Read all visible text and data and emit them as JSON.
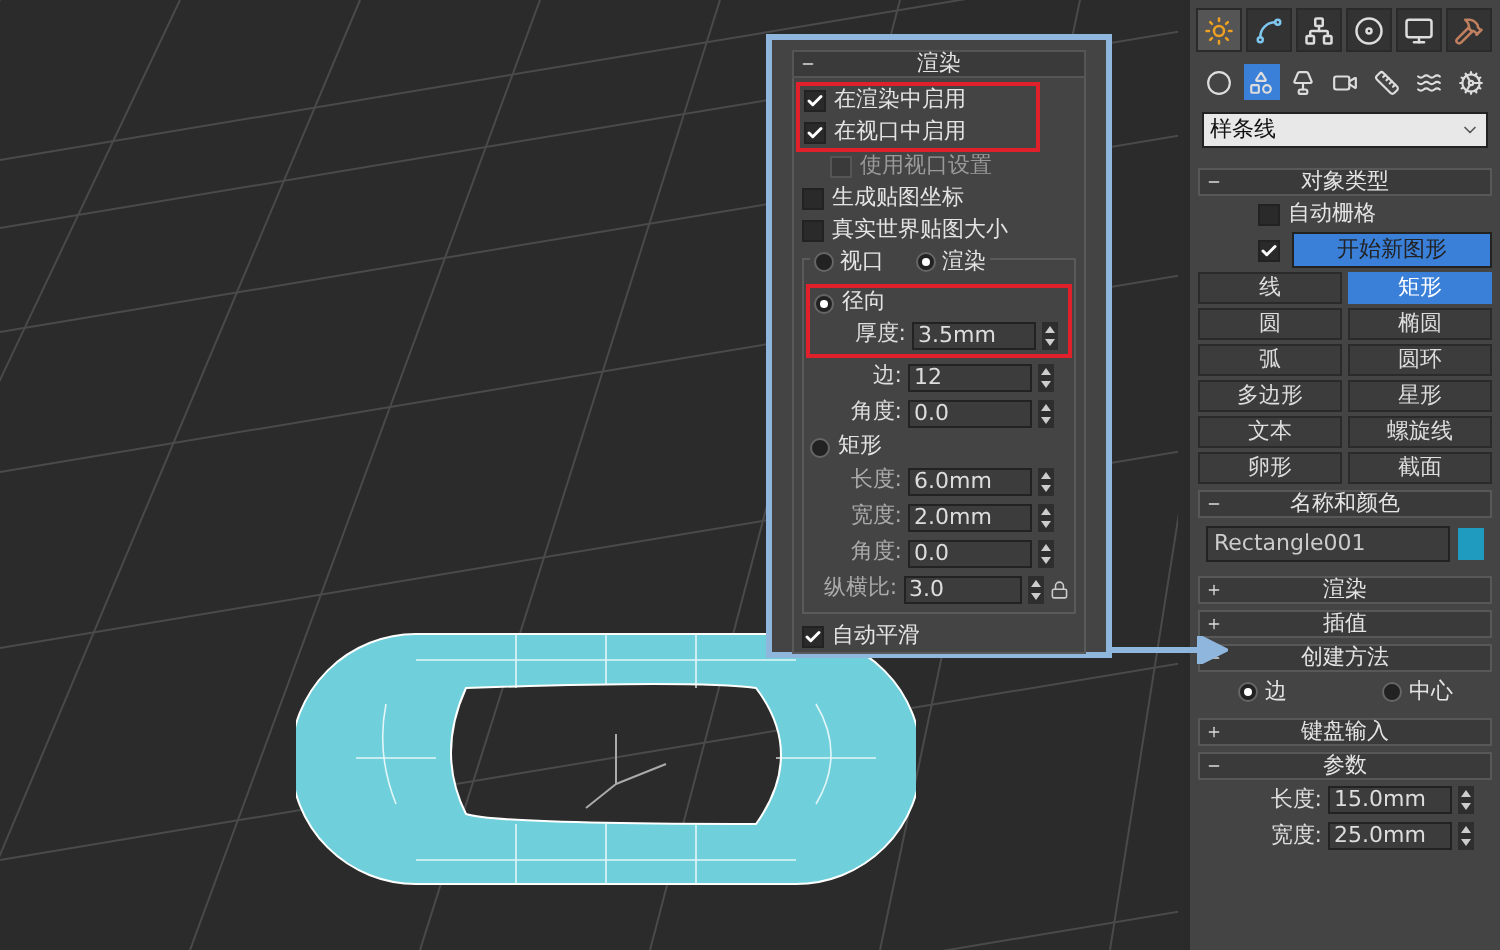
{
  "render_rollout": {
    "title": "渲染",
    "expanded": true,
    "checkboxes": [
      {
        "label": "在渲染中启用",
        "checked": true,
        "highlighted": true
      },
      {
        "label": "在视口中启用",
        "checked": true,
        "highlighted": true,
        "children": [
          {
            "label": "使用视口设置",
            "checked": false,
            "disabled": true
          }
        ]
      },
      {
        "label": "生成贴图坐标",
        "checked": false
      },
      {
        "label": "真实世界贴图大小",
        "checked": false
      }
    ],
    "mode_radios": [
      {
        "label": "视口",
        "selected": false
      },
      {
        "label": "渲染",
        "selected": true
      }
    ],
    "sections": [
      {
        "label": "径向",
        "selected": true,
        "highlighted": true,
        "fields": [
          {
            "label": "厚度:",
            "value": "3.5mm",
            "highlighted": true
          },
          {
            "label": "边:",
            "value": "12"
          },
          {
            "label": "角度:",
            "value": "0.0"
          }
        ]
      },
      {
        "label": "矩形",
        "selected": false,
        "fields": [
          {
            "label": "长度:",
            "value": "6.0mm"
          },
          {
            "label": "宽度:",
            "value": "2.0mm"
          },
          {
            "label": "角度:",
            "value": "0.0"
          },
          {
            "label": "纵横比:",
            "value": "3.0",
            "lock": true
          }
        ]
      }
    ],
    "auto_smooth": {
      "label": "自动平滑",
      "checked": true
    }
  },
  "command_panel": {
    "tabs": [
      {
        "kind": "create",
        "selected": true
      },
      {
        "kind": "modify",
        "selected": false
      },
      {
        "kind": "hierarchy",
        "selected": false
      },
      {
        "kind": "motion",
        "selected": false
      },
      {
        "kind": "display",
        "selected": false
      },
      {
        "kind": "utilities",
        "selected": false
      }
    ],
    "categories": [
      {
        "kind": "geometry",
        "selected": false
      },
      {
        "kind": "shapes",
        "selected": true
      },
      {
        "kind": "lights",
        "selected": false
      },
      {
        "kind": "cameras",
        "selected": false
      },
      {
        "kind": "helpers",
        "selected": false
      },
      {
        "kind": "spacewarps",
        "selected": false
      },
      {
        "kind": "systems",
        "selected": false
      }
    ],
    "dropdown": "样条线",
    "rollouts": [
      {
        "kind": "object_type",
        "title": "对象类型",
        "expanded": true,
        "auto_grid": {
          "label": "自动栅格",
          "checked": false
        },
        "start_new_shape": {
          "label": "开始新图形",
          "checked": true
        },
        "buttons": [
          {
            "label": "线",
            "selected": false
          },
          {
            "label": "矩形",
            "selected": true
          },
          {
            "label": "圆",
            "selected": false
          },
          {
            "label": "椭圆",
            "selected": false
          },
          {
            "label": "弧",
            "selected": false
          },
          {
            "label": "圆环",
            "selected": false
          },
          {
            "label": "多边形",
            "selected": false
          },
          {
            "label": "星形",
            "selected": false
          },
          {
            "label": "文本",
            "selected": false
          },
          {
            "label": "螺旋线",
            "selected": false
          },
          {
            "label": "卵形",
            "selected": false
          },
          {
            "label": "截面",
            "selected": false
          }
        ]
      },
      {
        "kind": "name_color",
        "title": "名称和颜色",
        "expanded": true,
        "name": "Rectangle001",
        "color": "#1e9bbf"
      },
      {
        "title": "渲染",
        "expanded": false
      },
      {
        "title": "插值",
        "expanded": false
      },
      {
        "kind": "creation_method",
        "title": "创建方法",
        "expanded": true,
        "radios": [
          {
            "label": "边",
            "selected": true
          },
          {
            "label": "中心",
            "selected": false
          }
        ]
      },
      {
        "title": "键盘输入",
        "expanded": false
      },
      {
        "kind": "parameters",
        "title": "参数",
        "expanded": true,
        "fields": [
          {
            "label": "长度:",
            "value": "15.0mm"
          },
          {
            "label": "宽度:",
            "value": "25.0mm"
          }
        ]
      }
    ]
  }
}
